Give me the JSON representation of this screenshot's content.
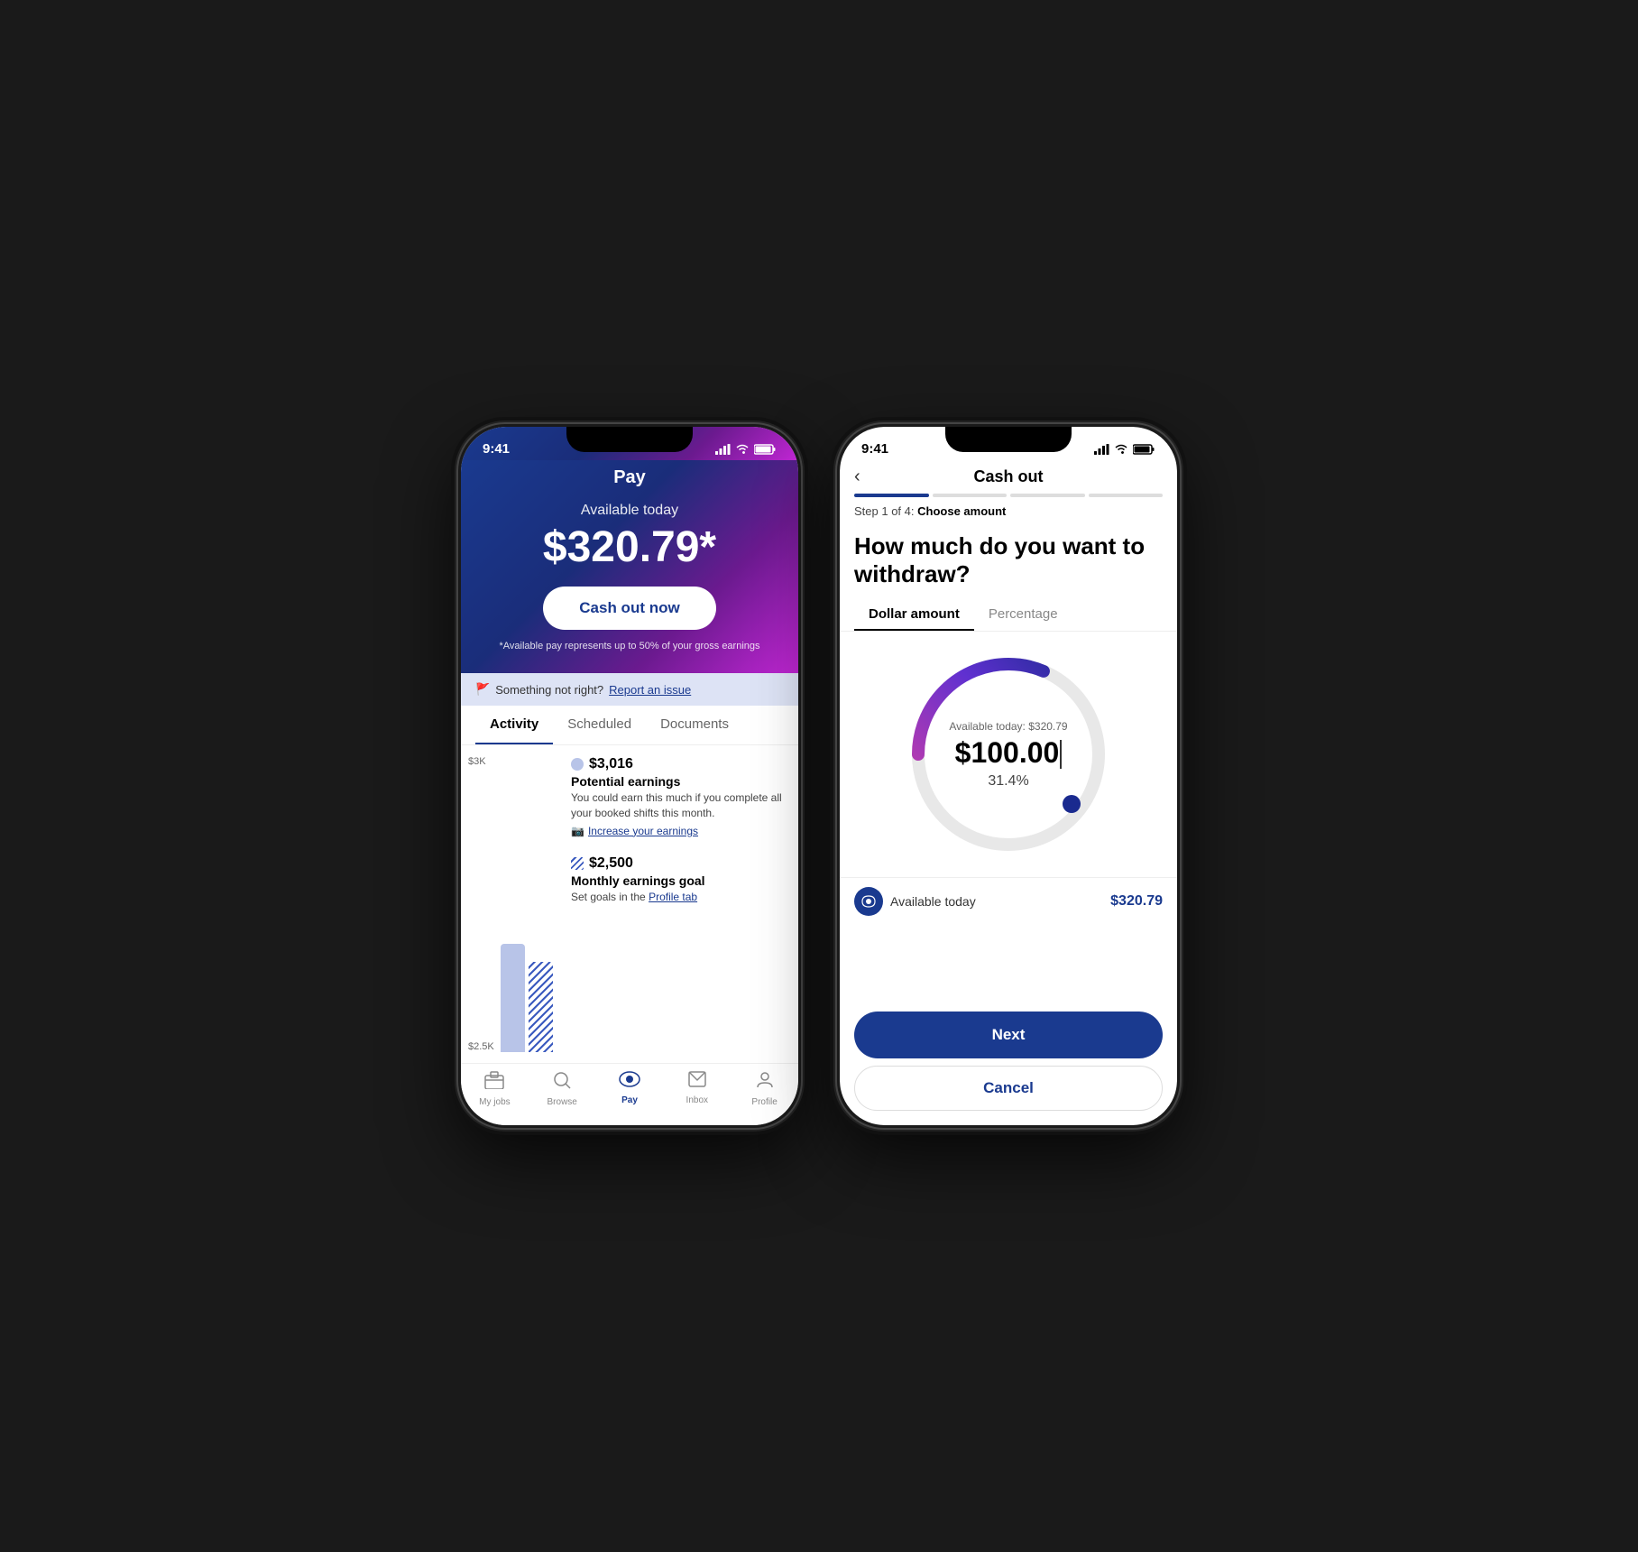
{
  "left_phone": {
    "status": {
      "time": "9:41"
    },
    "header": {
      "title": "Pay",
      "available_label": "Available today",
      "amount": "$320.79*",
      "cashout_btn": "Cash out now",
      "disclaimer": "*Available pay represents up to 50% of your gross earnings"
    },
    "report_bar": {
      "text": "Something not right?",
      "link": "Report an issue"
    },
    "tabs": [
      "Activity",
      "Scheduled",
      "Documents"
    ],
    "active_tab": "Activity",
    "chart": {
      "label_3k": "$3K",
      "label_2_5k": "$2.5K"
    },
    "earnings": [
      {
        "amount": "$3,016",
        "title": "Potential earnings",
        "description": "You could earn this much if you complete all your booked shifts this month.",
        "link": "Increase your earnings",
        "badge_type": "circle"
      },
      {
        "amount": "$2,500",
        "title": "Monthly earnings goal",
        "description": "Set goals in the",
        "link": "Profile tab",
        "badge_type": "striped"
      }
    ],
    "nav": [
      {
        "label": "My jobs",
        "icon": "📅",
        "active": false
      },
      {
        "label": "Browse",
        "icon": "🔍",
        "active": false
      },
      {
        "label": "Pay",
        "icon": "👁",
        "active": true
      },
      {
        "label": "Inbox",
        "icon": "💬",
        "active": false
      },
      {
        "label": "Profile",
        "icon": "👤",
        "active": false
      }
    ]
  },
  "right_phone": {
    "status": {
      "time": "9:41"
    },
    "header": {
      "back": "‹",
      "title": "Cash out"
    },
    "progress": {
      "step": "Step 1 of 4:",
      "step_label": "Choose amount",
      "total_steps": 4,
      "current_step": 1
    },
    "question": "How much do you want to withdraw?",
    "tabs": [
      "Dollar amount",
      "Percentage"
    ],
    "active_tab": "Dollar amount",
    "dial": {
      "available_label": "Available today: $320.79",
      "amount": "$100.00",
      "percent": "31.4%",
      "percentage_value": 31.4
    },
    "available_row": {
      "label": "Available today",
      "amount": "$320.79"
    },
    "buttons": {
      "next": "Next",
      "cancel": "Cancel"
    }
  }
}
